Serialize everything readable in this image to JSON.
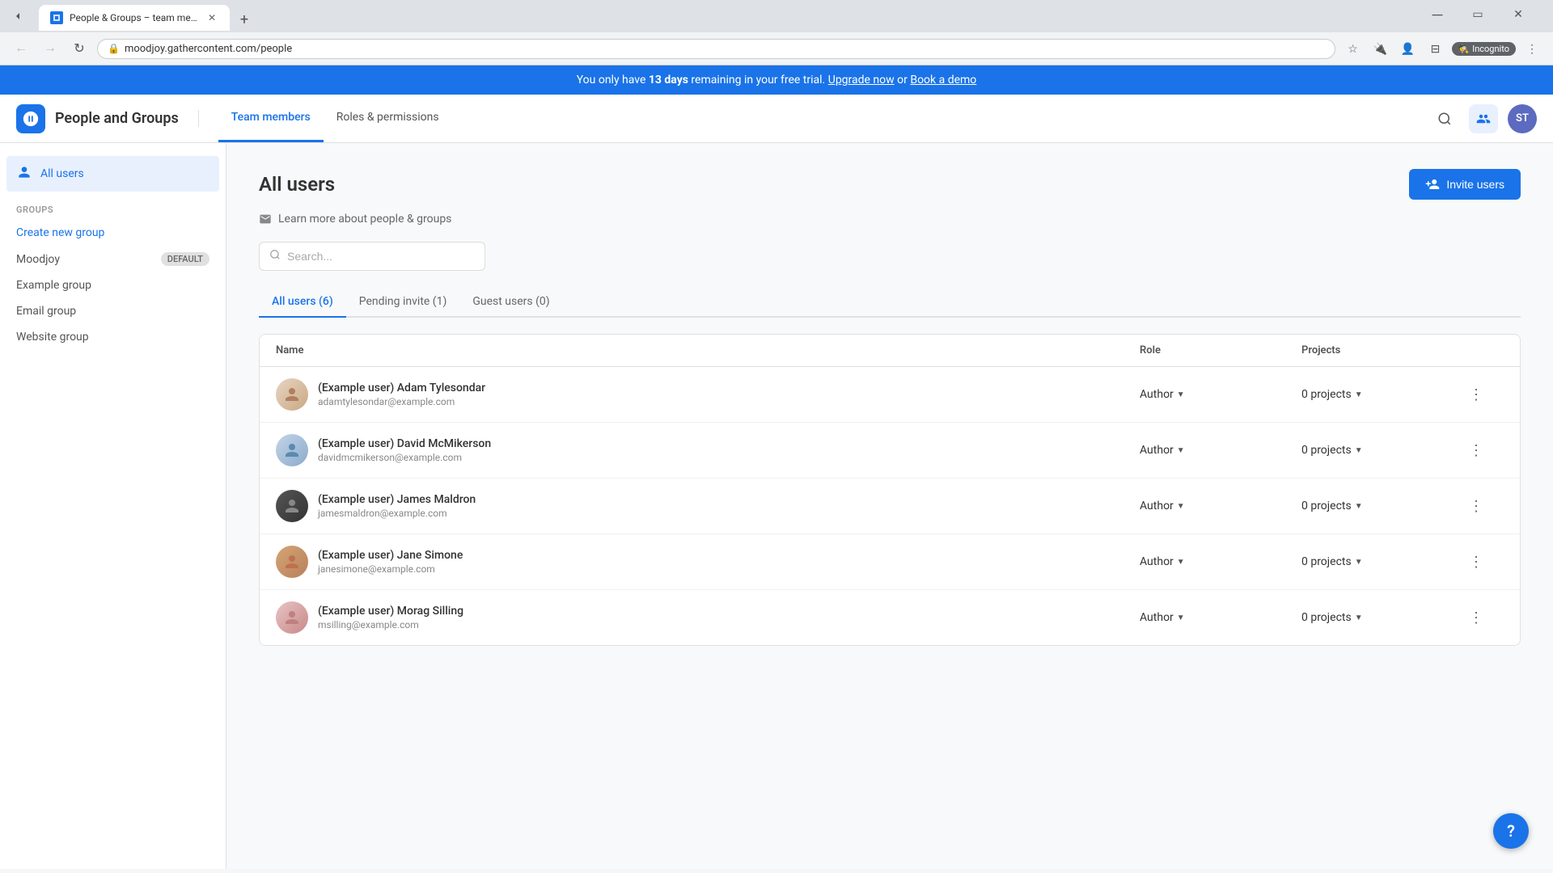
{
  "browser": {
    "tab_title": "People & Groups – team mem...",
    "address": "moodjoy.gathercontent.com/people",
    "incognito_label": "Incognito",
    "new_tab_icon": "+",
    "back_disabled": false,
    "forward_disabled": true
  },
  "banner": {
    "text_pre": "You only have ",
    "days": "13 days",
    "text_mid": " remaining in your free trial. ",
    "upgrade_label": "Upgrade now",
    "text_or": " or ",
    "demo_label": "Book a demo"
  },
  "header": {
    "title": "People and Groups",
    "nav": [
      {
        "label": "Team members",
        "active": true
      },
      {
        "label": "Roles & permissions",
        "active": false
      }
    ],
    "avatar_initials": "ST"
  },
  "sidebar": {
    "all_users_label": "All users",
    "groups_section_label": "GROUPS",
    "create_group_label": "Create new group",
    "groups": [
      {
        "name": "Moodjoy",
        "badge": "DEFAULT"
      },
      {
        "name": "Example group",
        "badge": ""
      },
      {
        "name": "Email group",
        "badge": ""
      },
      {
        "name": "Website group",
        "badge": ""
      }
    ]
  },
  "content": {
    "page_title": "All users",
    "learn_more_label": "Learn more about people & groups",
    "invite_btn_label": "Invite users",
    "search_placeholder": "Search...",
    "tabs": [
      {
        "label": "All users (6)",
        "active": true
      },
      {
        "label": "Pending invite (1)",
        "active": false
      },
      {
        "label": "Guest users (0)",
        "active": false
      }
    ],
    "table_headers": [
      "Name",
      "Role",
      "Projects",
      ""
    ],
    "users": [
      {
        "name": "(Example user) Adam Tylesondar",
        "email": "adamtylesondar@example.com",
        "role": "Author",
        "projects": "0 projects",
        "avatar_type": "adam"
      },
      {
        "name": "(Example user) David McMikerson",
        "email": "davidmcmikerson@example.com",
        "role": "Author",
        "projects": "0 projects",
        "avatar_type": "david"
      },
      {
        "name": "(Example user) James Maldron",
        "email": "jamesmaldron@example.com",
        "role": "Author",
        "projects": "0 projects",
        "avatar_type": "james"
      },
      {
        "name": "(Example user) Jane Simone",
        "email": "janesimone@example.com",
        "role": "Author",
        "projects": "0 projects",
        "avatar_type": "jane"
      },
      {
        "name": "(Example user) Morag Silling",
        "email": "msilling@example.com",
        "role": "Author",
        "projects": "0 projects",
        "avatar_type": "morag"
      }
    ]
  },
  "help_btn_label": "?"
}
